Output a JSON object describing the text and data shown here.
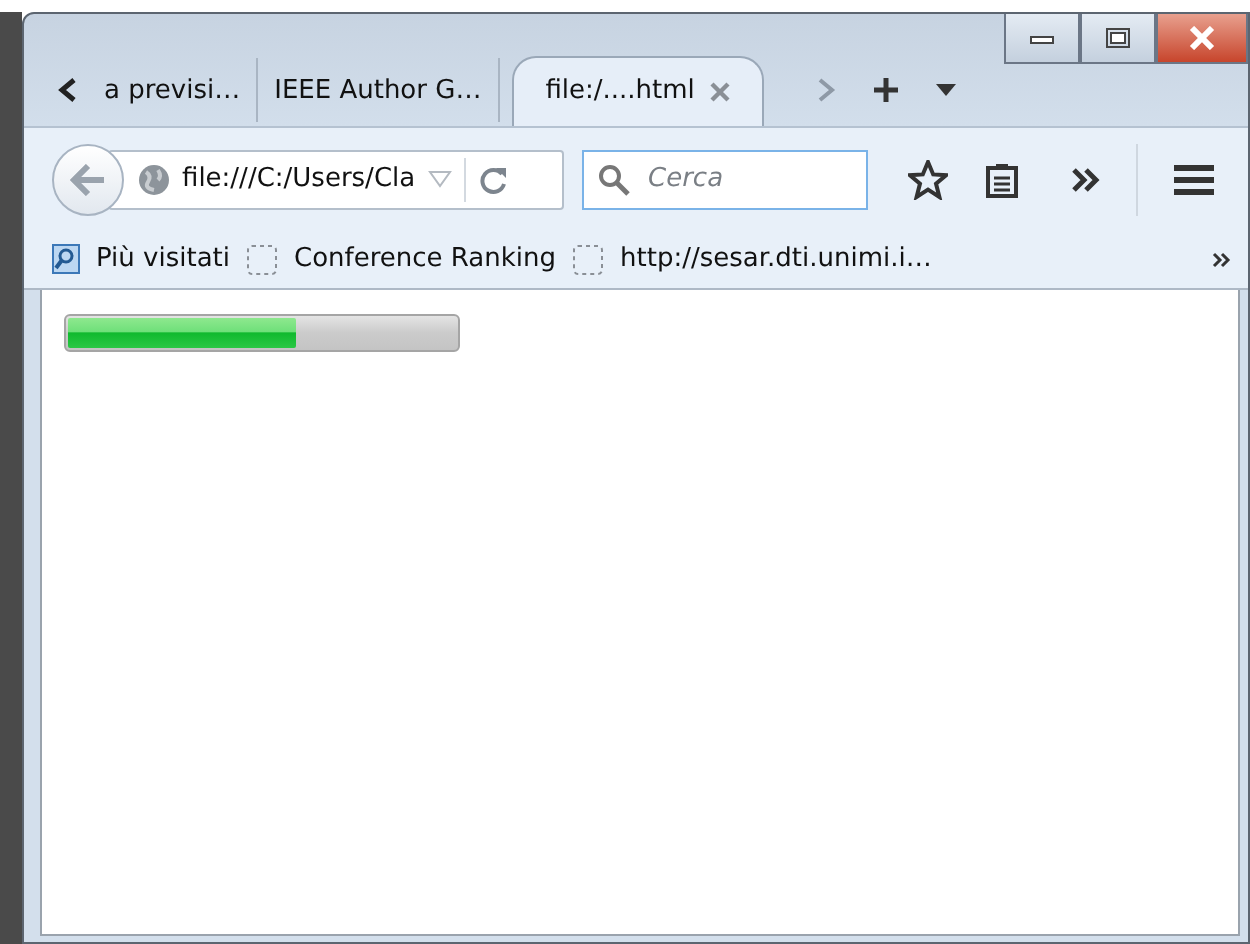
{
  "tabs": [
    {
      "label": "a previsi…",
      "selected": false
    },
    {
      "label": "IEEE Author G…",
      "selected": false
    },
    {
      "label": "file:/....html",
      "selected": true
    }
  ],
  "navigation": {
    "url": "file:///C:/Users/Cla",
    "search": {
      "placeholder": "Cerca"
    }
  },
  "bookmarks": [
    {
      "label": "Più visitati",
      "kind": "folder"
    },
    {
      "label": "Conference Ranking",
      "kind": "page"
    },
    {
      "label": "http://sesar.dti.unimi.i…",
      "kind": "page"
    }
  ],
  "progress": {
    "level": 0.59
  }
}
